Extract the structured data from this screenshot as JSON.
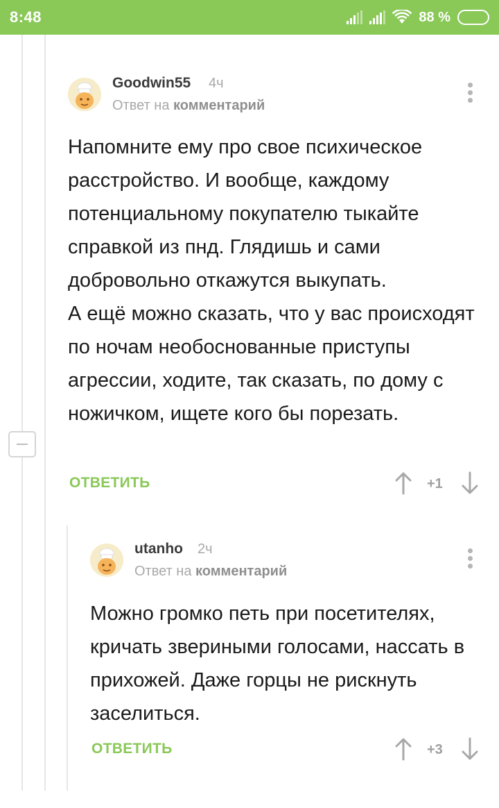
{
  "status_bar": {
    "time": "8:48",
    "battery_percent": "88 %",
    "battery_level": 0.88
  },
  "comments": [
    {
      "author": "Goodwin55",
      "time": "4ч",
      "reply_prefix": "Ответ на",
      "reply_link": "комментарий",
      "body": "Напомните ему про свое психическое расстройство. И вообще, каждому потенциальному покупателю тыкайте справкой из пнд. Глядишь и сами добровольно откажутся выкупать.\nА ещё можно сказать, что у вас происходят по ночам необоснованные приступы агрессии, ходите, так сказать, по дому с ножичком, ищете кого бы порезать.",
      "reply_label": "ОТВЕТИТЬ",
      "rating": "+1"
    },
    {
      "author": "utanho",
      "time": "2ч",
      "reply_prefix": "Ответ на",
      "reply_link": "комментарий",
      "body": "Можно громко петь при посетителях, кричать звериными голосами, нассать в прихожей. Даже горцы не рискнуть заселиться.",
      "reply_label": "ОТВЕТИТЬ",
      "rating": "+3"
    }
  ],
  "colors": {
    "accent": "#8ac858",
    "status_bar": "#8ac858"
  }
}
